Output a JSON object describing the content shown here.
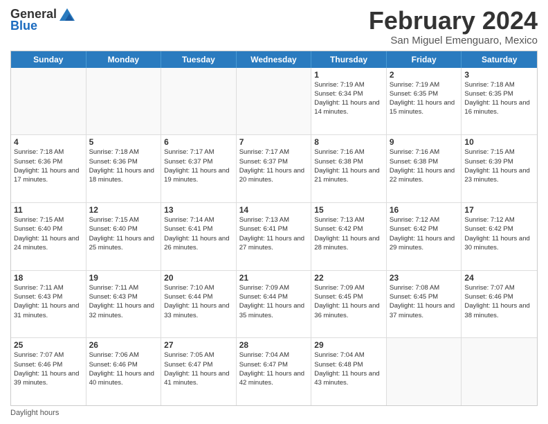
{
  "logo": {
    "general": "General",
    "blue": "Blue"
  },
  "title": "February 2024",
  "subtitle": "San Miguel Emenguaro, Mexico",
  "days_of_week": [
    "Sunday",
    "Monday",
    "Tuesday",
    "Wednesday",
    "Thursday",
    "Friday",
    "Saturday"
  ],
  "weeks": [
    [
      {
        "day": "",
        "sunrise": "",
        "sunset": "",
        "daylight": ""
      },
      {
        "day": "",
        "sunrise": "",
        "sunset": "",
        "daylight": ""
      },
      {
        "day": "",
        "sunrise": "",
        "sunset": "",
        "daylight": ""
      },
      {
        "day": "",
        "sunrise": "",
        "sunset": "",
        "daylight": ""
      },
      {
        "day": "1",
        "sunrise": "Sunrise: 7:19 AM",
        "sunset": "Sunset: 6:34 PM",
        "daylight": "Daylight: 11 hours and 14 minutes."
      },
      {
        "day": "2",
        "sunrise": "Sunrise: 7:19 AM",
        "sunset": "Sunset: 6:35 PM",
        "daylight": "Daylight: 11 hours and 15 minutes."
      },
      {
        "day": "3",
        "sunrise": "Sunrise: 7:18 AM",
        "sunset": "Sunset: 6:35 PM",
        "daylight": "Daylight: 11 hours and 16 minutes."
      }
    ],
    [
      {
        "day": "4",
        "sunrise": "Sunrise: 7:18 AM",
        "sunset": "Sunset: 6:36 PM",
        "daylight": "Daylight: 11 hours and 17 minutes."
      },
      {
        "day": "5",
        "sunrise": "Sunrise: 7:18 AM",
        "sunset": "Sunset: 6:36 PM",
        "daylight": "Daylight: 11 hours and 18 minutes."
      },
      {
        "day": "6",
        "sunrise": "Sunrise: 7:17 AM",
        "sunset": "Sunset: 6:37 PM",
        "daylight": "Daylight: 11 hours and 19 minutes."
      },
      {
        "day": "7",
        "sunrise": "Sunrise: 7:17 AM",
        "sunset": "Sunset: 6:37 PM",
        "daylight": "Daylight: 11 hours and 20 minutes."
      },
      {
        "day": "8",
        "sunrise": "Sunrise: 7:16 AM",
        "sunset": "Sunset: 6:38 PM",
        "daylight": "Daylight: 11 hours and 21 minutes."
      },
      {
        "day": "9",
        "sunrise": "Sunrise: 7:16 AM",
        "sunset": "Sunset: 6:38 PM",
        "daylight": "Daylight: 11 hours and 22 minutes."
      },
      {
        "day": "10",
        "sunrise": "Sunrise: 7:15 AM",
        "sunset": "Sunset: 6:39 PM",
        "daylight": "Daylight: 11 hours and 23 minutes."
      }
    ],
    [
      {
        "day": "11",
        "sunrise": "Sunrise: 7:15 AM",
        "sunset": "Sunset: 6:40 PM",
        "daylight": "Daylight: 11 hours and 24 minutes."
      },
      {
        "day": "12",
        "sunrise": "Sunrise: 7:15 AM",
        "sunset": "Sunset: 6:40 PM",
        "daylight": "Daylight: 11 hours and 25 minutes."
      },
      {
        "day": "13",
        "sunrise": "Sunrise: 7:14 AM",
        "sunset": "Sunset: 6:41 PM",
        "daylight": "Daylight: 11 hours and 26 minutes."
      },
      {
        "day": "14",
        "sunrise": "Sunrise: 7:13 AM",
        "sunset": "Sunset: 6:41 PM",
        "daylight": "Daylight: 11 hours and 27 minutes."
      },
      {
        "day": "15",
        "sunrise": "Sunrise: 7:13 AM",
        "sunset": "Sunset: 6:42 PM",
        "daylight": "Daylight: 11 hours and 28 minutes."
      },
      {
        "day": "16",
        "sunrise": "Sunrise: 7:12 AM",
        "sunset": "Sunset: 6:42 PM",
        "daylight": "Daylight: 11 hours and 29 minutes."
      },
      {
        "day": "17",
        "sunrise": "Sunrise: 7:12 AM",
        "sunset": "Sunset: 6:42 PM",
        "daylight": "Daylight: 11 hours and 30 minutes."
      }
    ],
    [
      {
        "day": "18",
        "sunrise": "Sunrise: 7:11 AM",
        "sunset": "Sunset: 6:43 PM",
        "daylight": "Daylight: 11 hours and 31 minutes."
      },
      {
        "day": "19",
        "sunrise": "Sunrise: 7:11 AM",
        "sunset": "Sunset: 6:43 PM",
        "daylight": "Daylight: 11 hours and 32 minutes."
      },
      {
        "day": "20",
        "sunrise": "Sunrise: 7:10 AM",
        "sunset": "Sunset: 6:44 PM",
        "daylight": "Daylight: 11 hours and 33 minutes."
      },
      {
        "day": "21",
        "sunrise": "Sunrise: 7:09 AM",
        "sunset": "Sunset: 6:44 PM",
        "daylight": "Daylight: 11 hours and 35 minutes."
      },
      {
        "day": "22",
        "sunrise": "Sunrise: 7:09 AM",
        "sunset": "Sunset: 6:45 PM",
        "daylight": "Daylight: 11 hours and 36 minutes."
      },
      {
        "day": "23",
        "sunrise": "Sunrise: 7:08 AM",
        "sunset": "Sunset: 6:45 PM",
        "daylight": "Daylight: 11 hours and 37 minutes."
      },
      {
        "day": "24",
        "sunrise": "Sunrise: 7:07 AM",
        "sunset": "Sunset: 6:46 PM",
        "daylight": "Daylight: 11 hours and 38 minutes."
      }
    ],
    [
      {
        "day": "25",
        "sunrise": "Sunrise: 7:07 AM",
        "sunset": "Sunset: 6:46 PM",
        "daylight": "Daylight: 11 hours and 39 minutes."
      },
      {
        "day": "26",
        "sunrise": "Sunrise: 7:06 AM",
        "sunset": "Sunset: 6:46 PM",
        "daylight": "Daylight: 11 hours and 40 minutes."
      },
      {
        "day": "27",
        "sunrise": "Sunrise: 7:05 AM",
        "sunset": "Sunset: 6:47 PM",
        "daylight": "Daylight: 11 hours and 41 minutes."
      },
      {
        "day": "28",
        "sunrise": "Sunrise: 7:04 AM",
        "sunset": "Sunset: 6:47 PM",
        "daylight": "Daylight: 11 hours and 42 minutes."
      },
      {
        "day": "29",
        "sunrise": "Sunrise: 7:04 AM",
        "sunset": "Sunset: 6:48 PM",
        "daylight": "Daylight: 11 hours and 43 minutes."
      },
      {
        "day": "",
        "sunrise": "",
        "sunset": "",
        "daylight": ""
      },
      {
        "day": "",
        "sunrise": "",
        "sunset": "",
        "daylight": ""
      }
    ]
  ],
  "footer": "Daylight hours"
}
